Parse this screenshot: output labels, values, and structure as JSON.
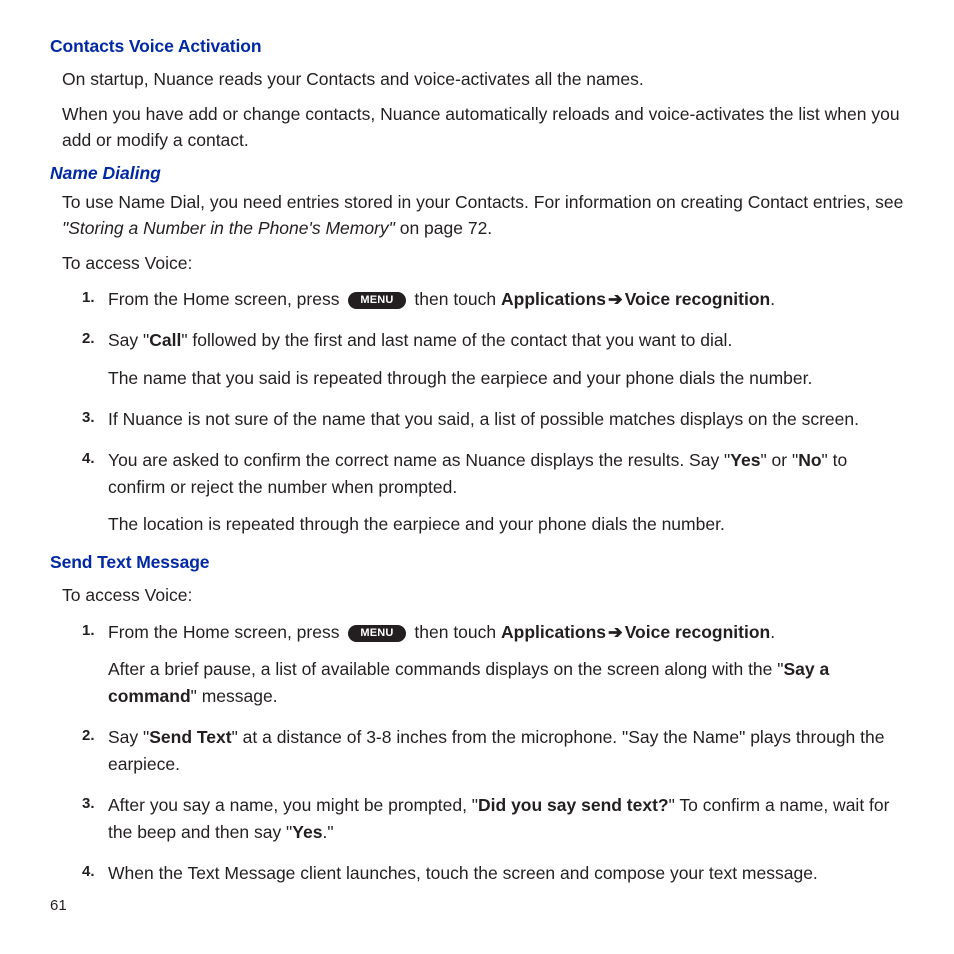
{
  "sections": {
    "s1": {
      "heading": "Contacts Voice Activation",
      "p1": "On startup, Nuance reads your Contacts and voice-activates all the names.",
      "p2": "When you have add or change contacts, Nuance automatically reloads and voice-activates the list when you add or modify a contact."
    },
    "s2": {
      "heading": "Name Dialing",
      "p1_a": "To use Name Dial, you need entries stored in your Contacts. For information on creating Contact entries, see ",
      "p1_ref": "\"Storing a Number in the Phone's Memory\"",
      "p1_b": " on page 72.",
      "p2": "To access Voice:",
      "items": {
        "i1": {
          "n": "1.",
          "a": "From the Home screen, press ",
          "menu": "MENU",
          "b": " then touch ",
          "bold1": "Applications",
          "arrow": "➔",
          "bold2": "Voice recognition",
          "c": "."
        },
        "i2": {
          "n": "2.",
          "a": "Say \"",
          "bold1": "Call",
          "b": "\" followed by the first and last name of the contact that you want to dial.",
          "sub": "The name that you said is repeated through the earpiece and your phone dials the number."
        },
        "i3": {
          "n": "3.",
          "a": "If Nuance is not sure of the name that you said, a list of possible matches displays on the screen."
        },
        "i4": {
          "n": "4.",
          "a": "You are asked to confirm the correct name as Nuance displays the results. Say \"",
          "bold1": "Yes",
          "b": "\" or \"",
          "bold2": "No",
          "c": "\" to confirm or reject the number when prompted.",
          "sub": "The location is repeated through the earpiece and your phone dials the number."
        }
      }
    },
    "s3": {
      "heading": "Send Text Message",
      "p1": "To access Voice:",
      "items": {
        "i1": {
          "n": "1.",
          "a": "From the Home screen, press ",
          "menu": "MENU",
          "b": " then touch ",
          "bold1": "Applications",
          "arrow": "➔",
          "bold2": "Voice recognition",
          "c": ".",
          "sub_a": "After a brief pause, a list of available commands displays on the screen along with the \"",
          "sub_bold": "Say a command",
          "sub_b": "\" message."
        },
        "i2": {
          "n": "2.",
          "a": "Say \"",
          "bold1": "Send Text",
          "b": "\" at a distance of 3-8 inches from the microphone. \"Say the Name\" plays through the earpiece."
        },
        "i3": {
          "n": "3.",
          "a": "After you say a name, you might be prompted, \"",
          "bold1": "Did you say send text?",
          "b": "\" To confirm a name, wait for the beep and then say \"",
          "bold2": "Yes",
          "c": ".\""
        },
        "i4": {
          "n": "4.",
          "a": "When the Text Message client launches, touch the screen and compose your text message."
        }
      }
    }
  },
  "page_number": "61"
}
